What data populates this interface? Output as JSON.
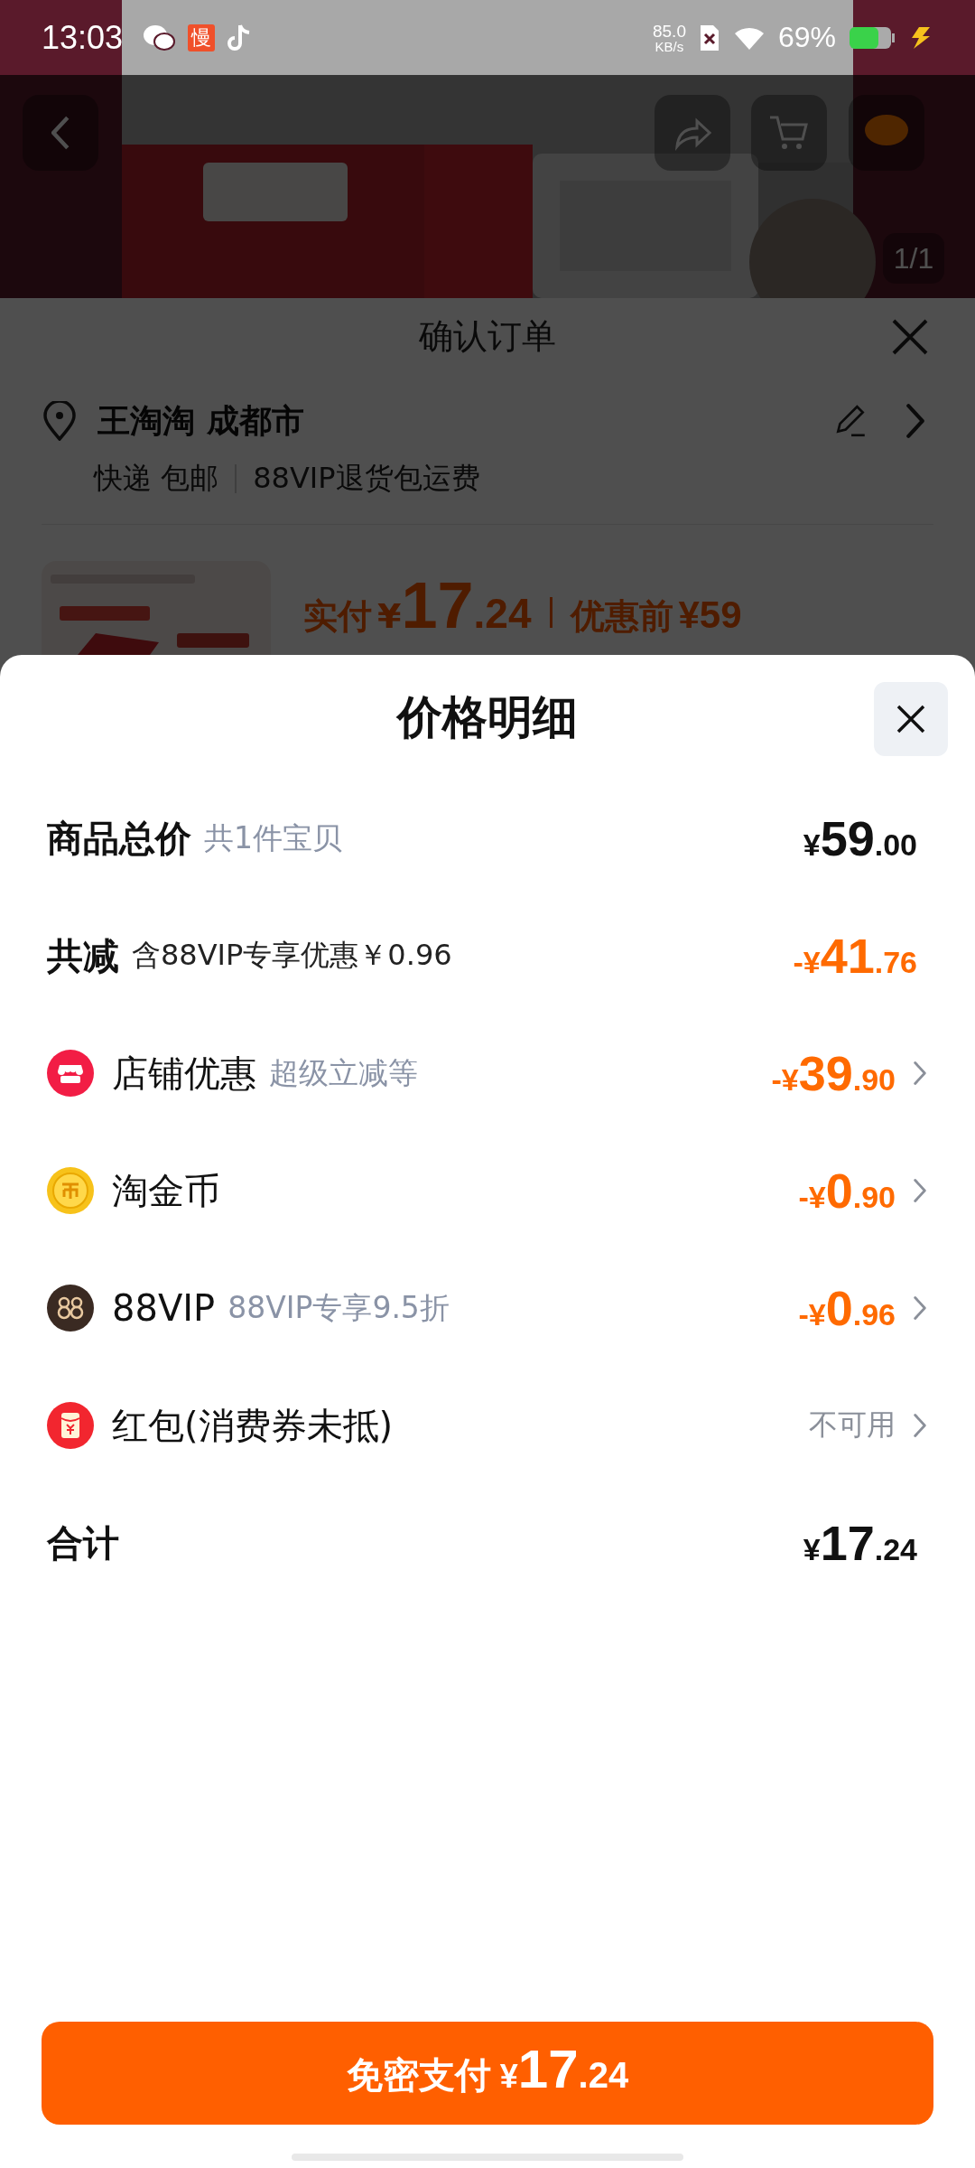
{
  "status_bar": {
    "time": "13:03",
    "app_badge": "慢",
    "speed": "85.0",
    "speed_unit": "KB/s",
    "battery": "69%"
  },
  "product_header": {
    "kind": "picture",
    "page_counter": "1/1"
  },
  "order_sheet": {
    "title": "确认订单",
    "address": {
      "name": "王淘淘 成都市",
      "delivery": "快递 包邮",
      "service": "88VIP退货包运费"
    },
    "item": {
      "paid_label": "实付",
      "paid": "¥17.24",
      "before_label": "优惠前",
      "before": "¥59"
    }
  },
  "price_detail": {
    "title": "价格明细",
    "rows": [
      {
        "kind": "total",
        "label": "商品总价",
        "note": "共1件宝贝",
        "value": "¥59.00",
        "chevron": false
      },
      {
        "kind": "saving",
        "label": "共减",
        "note": "含88VIP专享优惠￥0.96",
        "value": "-¥41.76",
        "chevron": false
      },
      {
        "kind": "shop",
        "label": "店铺优惠",
        "note": "超级立减等",
        "value": "-¥39.90",
        "chevron": true
      },
      {
        "kind": "coin",
        "label": "淘金币",
        "value": "-¥0.90",
        "chevron": true
      },
      {
        "kind": "vip",
        "label": "88VIP",
        "note": "88VIP专享9.5折",
        "value": "-¥0.96",
        "chevron": true
      },
      {
        "kind": "packet",
        "label": "红包(消费券未抵)",
        "status": "不可用",
        "chevron": true
      },
      {
        "kind": "sum",
        "label": "合计",
        "value": "¥17.24",
        "chevron": false
      }
    ]
  },
  "pay_button": {
    "label": "免密支付",
    "amount": "¥17.24"
  }
}
